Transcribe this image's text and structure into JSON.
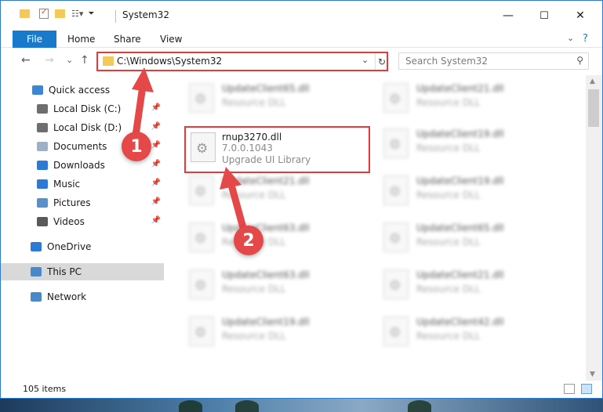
{
  "window": {
    "title": "System32",
    "controls": {
      "minimize": "—",
      "maximize": "☐",
      "close": "✕"
    }
  },
  "ribbon": {
    "tabs": [
      "File",
      "Home",
      "Share",
      "View"
    ]
  },
  "navigation": {
    "back": "←",
    "forward": "→",
    "recent": "⌄",
    "up": "↑",
    "address": "C:\\Windows\\System32",
    "search_placeholder": "Search System32"
  },
  "sidebar": {
    "items": [
      {
        "label": "Quick access",
        "icon": "star-icon",
        "color": "#3b86d6",
        "pinned": false
      },
      {
        "label": "Local Disk (C:)",
        "icon": "drive-icon",
        "color": "#6e6e6e",
        "pinned": true
      },
      {
        "label": "Local Disk (D:)",
        "icon": "drive-icon",
        "color": "#6e6e6e",
        "pinned": true
      },
      {
        "label": "Documents",
        "icon": "documents-icon",
        "color": "#9db0c8",
        "pinned": true
      },
      {
        "label": "Downloads",
        "icon": "download-icon",
        "color": "#2d7ad6",
        "pinned": true
      },
      {
        "label": "Music",
        "icon": "music-icon",
        "color": "#2d7ad6",
        "pinned": true
      },
      {
        "label": "Pictures",
        "icon": "pictures-icon",
        "color": "#5b8fc9",
        "pinned": true
      },
      {
        "label": "Videos",
        "icon": "videos-icon",
        "color": "#5a5a5a",
        "pinned": true
      },
      {
        "label": "OneDrive",
        "icon": "cloud-icon",
        "color": "#2d7ad6",
        "pinned": false
      },
      {
        "label": "This PC",
        "icon": "computer-icon",
        "color": "#4a88c7",
        "pinned": false,
        "selected": true
      },
      {
        "label": "Network",
        "icon": "network-icon",
        "color": "#4a88c7",
        "pinned": false
      }
    ]
  },
  "files": {
    "featured": {
      "name": "rnup3270.dll",
      "version": "7.0.0.1043",
      "description": "Upgrade UI Library"
    },
    "blurred": [
      {
        "name": "UpdateClient65.dll",
        "desc": "Resource DLL"
      },
      {
        "name": "UpdateClient21.dll",
        "desc": "Resource DLL"
      },
      {
        "name": "UpdateClient19.dll",
        "desc": "Resource DLL"
      },
      {
        "name": "UpdateClient21.dll",
        "desc": "Resource DLL"
      },
      {
        "name": "UpdateClient19.dll",
        "desc": "Resource DLL"
      },
      {
        "name": "UpdateClient63.dll",
        "desc": "Resource DLL"
      },
      {
        "name": "UpdateClient65.dll",
        "desc": "Resource DLL"
      },
      {
        "name": "UpdateClient63.dll",
        "desc": "Resource DLL"
      },
      {
        "name": "UpdateClient21.dll",
        "desc": "Resource DLL"
      },
      {
        "name": "UpdateClient19.dll",
        "desc": "Resource DLL"
      },
      {
        "name": "UpdateClient42.dll",
        "desc": "Resource DLL"
      }
    ]
  },
  "status": {
    "items_count": "105 items"
  },
  "callouts": {
    "step1": "1",
    "step2": "2"
  },
  "colors": {
    "accent": "#1979ca",
    "highlight": "#e53a3a",
    "badge": "#e44848"
  }
}
